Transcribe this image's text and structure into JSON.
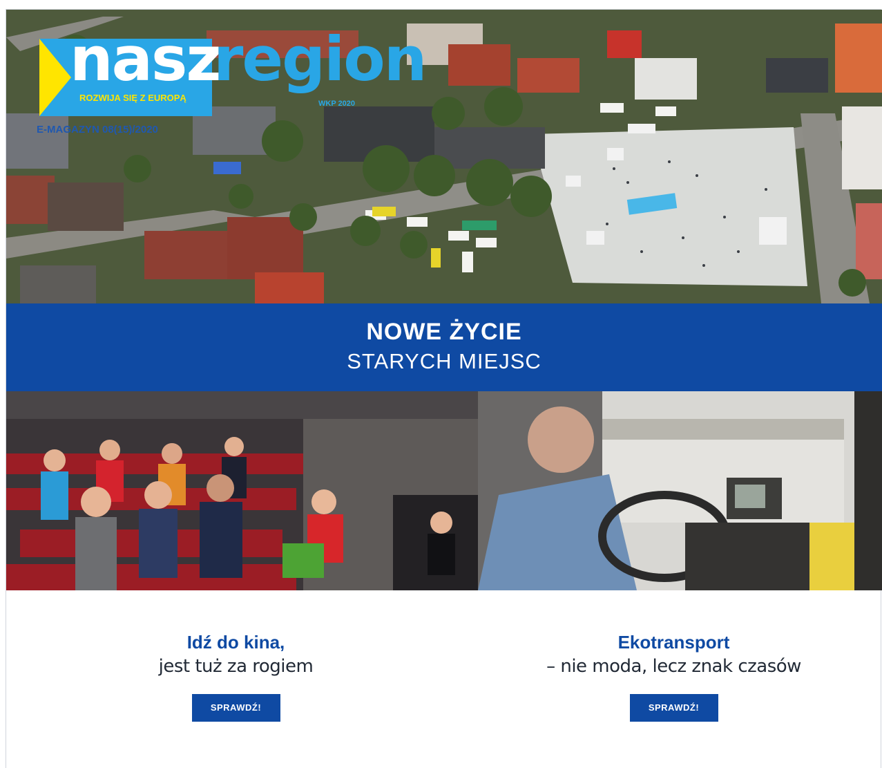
{
  "header": {
    "logo_word_1": "nasz",
    "logo_word_2": "region",
    "logo_tagline": "ROZWIJA SIĘ Z EUROPĄ",
    "logo_region_note": "WKP 2020",
    "issue": "E-MAGAZYN 08(15)/2020"
  },
  "banner": {
    "title": "NOWE ŻYCIE",
    "subtitle": "STARYCH MIEJSC"
  },
  "articles": [
    {
      "title": "Idź do kina,",
      "subtitle": "jest tuż za rogiem",
      "cta": "SPRAWDŹ!"
    },
    {
      "title": "Ekotransport",
      "subtitle": "– nie moda, lecz znak czasów",
      "cta": "SPRAWDŹ!"
    }
  ],
  "colors": {
    "brand_blue": "#0f4aa3",
    "logo_cyan": "#29a6e6",
    "logo_yellow": "#ffe500"
  }
}
